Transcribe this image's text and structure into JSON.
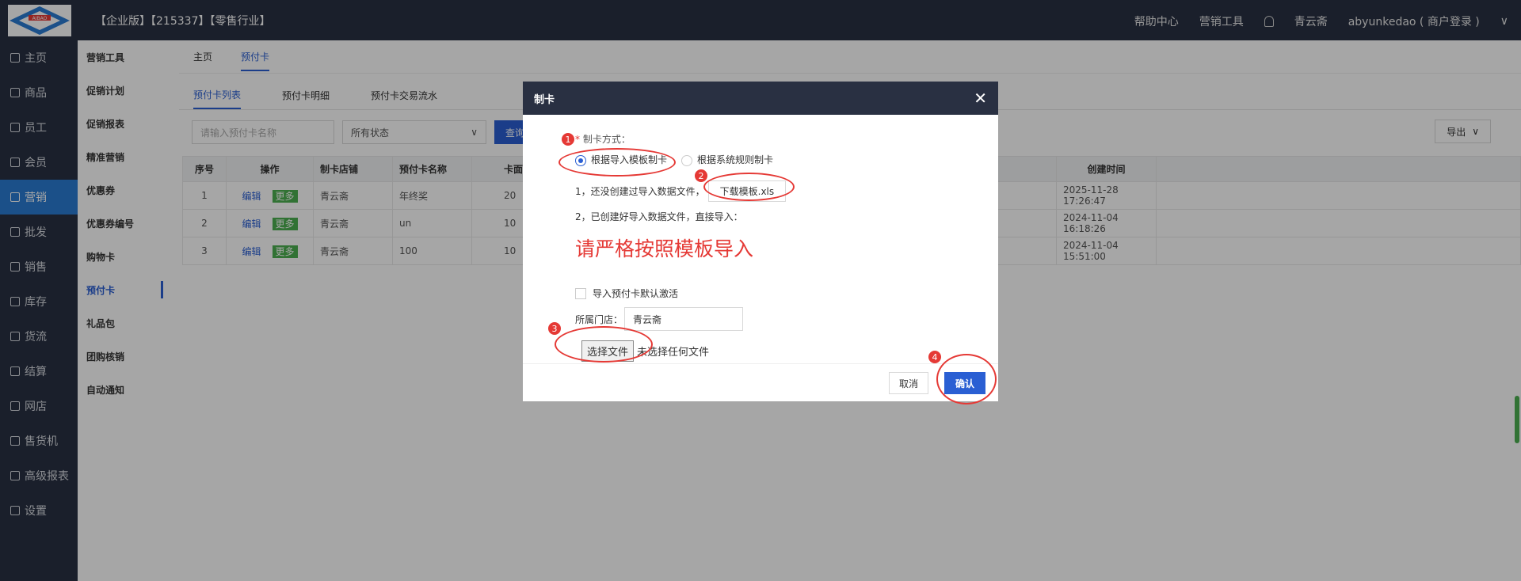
{
  "topbar": {
    "logo_text": "AIBAO",
    "title": "【企业版】【215337】【零售行业】",
    "help": "帮助中心",
    "marketing": "营销工具",
    "store": "青云斋",
    "account": "abyunkedao ( 商户登录 )"
  },
  "leftnav": [
    "主页",
    "商品",
    "员工",
    "会员",
    "营销",
    "批发",
    "销售",
    "库存",
    "货流",
    "结算",
    "网店",
    "售货机",
    "高级报表",
    "设置"
  ],
  "subnav": [
    "营销工具",
    "促销计划",
    "促销报表",
    "精准营销",
    "优惠券",
    "优惠券编号",
    "购物卡",
    "预付卡",
    "礼品包",
    "团购核销",
    "自动通知"
  ],
  "crumbs": [
    "主页",
    "预付卡"
  ],
  "tabs": [
    "预付卡列表",
    "预付卡明细",
    "预付卡交易流水"
  ],
  "filters": {
    "name_placeholder": "请输入预付卡名称",
    "status": "所有状态",
    "query": "查询",
    "export": "导出"
  },
  "table": {
    "headers": [
      "序号",
      "操作",
      "制卡店铺",
      "预付卡名称",
      "卡面",
      "创建时间"
    ],
    "edit": "编辑",
    "more": "更多",
    "rows": [
      {
        "no": "1",
        "store": "青云斋",
        "name": "年终奖",
        "face": "20",
        "time": "2025-11-28 17:26:47"
      },
      {
        "no": "2",
        "store": "青云斋",
        "name": "un",
        "face": "10",
        "time": "2024-11-04 16:18:26"
      },
      {
        "no": "3",
        "store": "青云斋",
        "name": "100",
        "face": "10",
        "time": "2024-11-04 15:51:00"
      }
    ]
  },
  "modal": {
    "title": "制卡",
    "method_label": "制卡方式：",
    "opt_template": "根据导入模板制卡",
    "opt_rule": "根据系统规则制卡",
    "step1": "1，还没创建过导入数据文件，",
    "download": "下载模板.xls",
    "step2": "2，已创建好导入数据文件，直接导入：",
    "warning": "请严格按照模板导入",
    "activate": "导入预付卡默认激活",
    "store_label": "所属门店：",
    "store_value": "青云斋",
    "choose_file": "选择文件",
    "no_file": "未选择任何文件",
    "cancel": "取消",
    "confirm": "确认"
  },
  "markers": [
    "1",
    "2",
    "3",
    "4"
  ],
  "colors": {
    "nav_bg": "#293042",
    "accent": "#2a5fd3",
    "active_nav": "#2a7bd3",
    "annotation": "#e53935"
  }
}
